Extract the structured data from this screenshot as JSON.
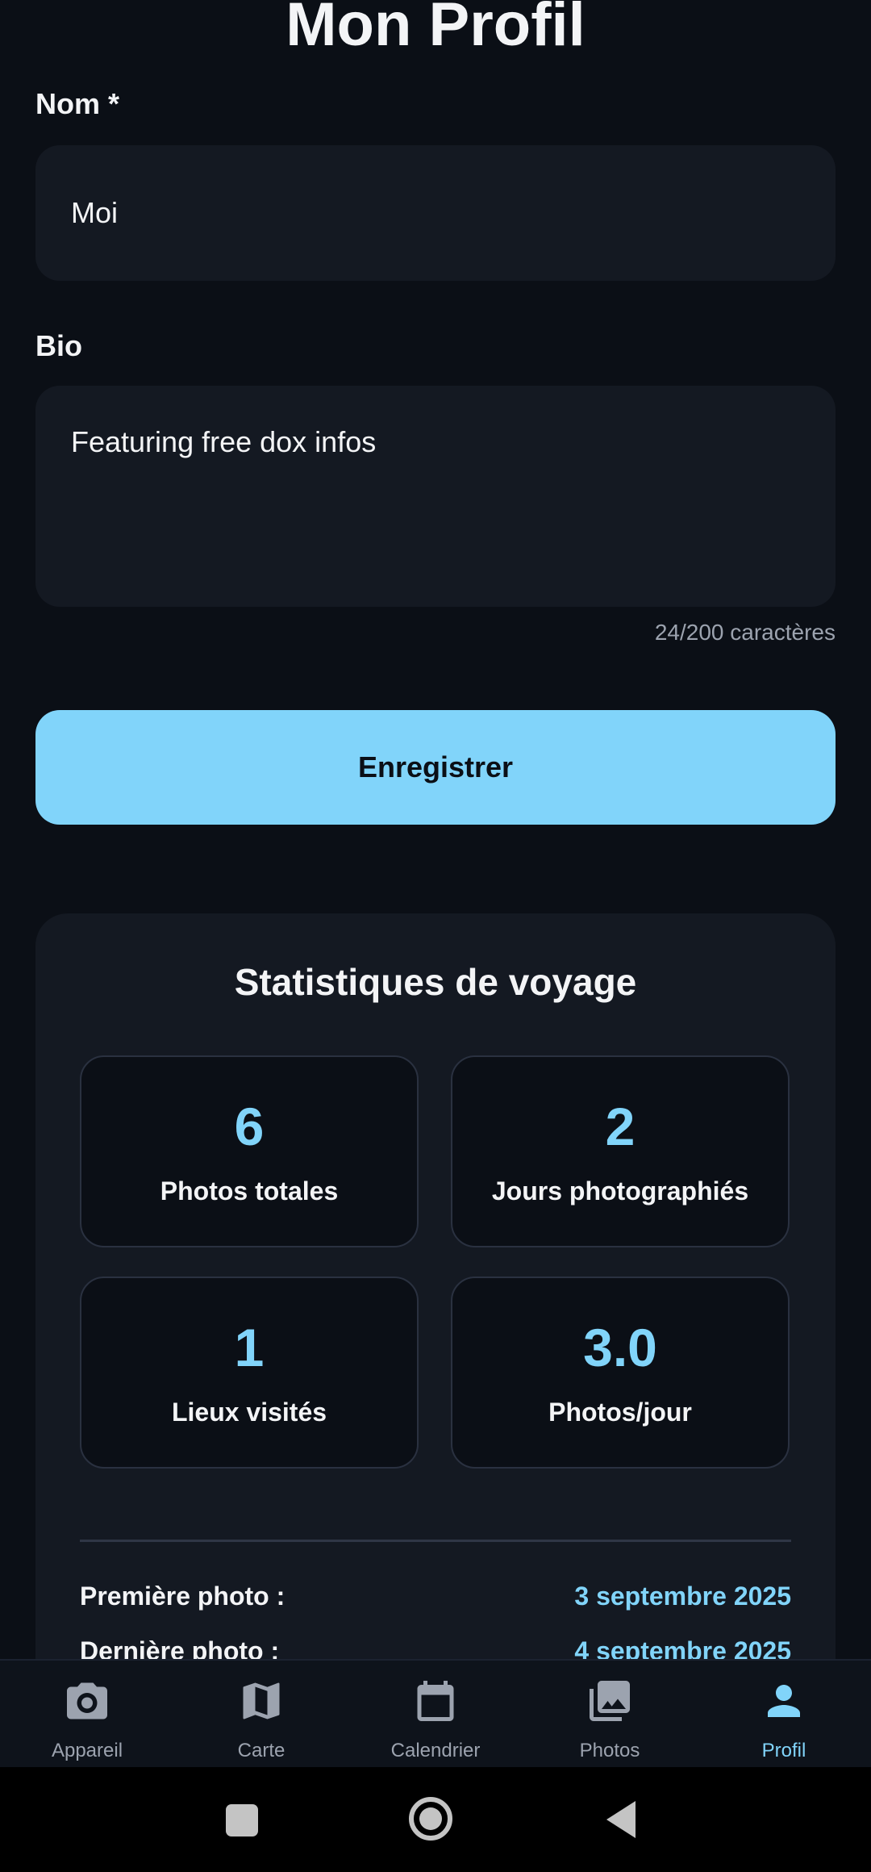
{
  "page": {
    "title": "Mon Profil"
  },
  "form": {
    "name_label": "Nom *",
    "name_value": "Moi",
    "bio_label": "Bio",
    "bio_value": "Featuring free dox infos",
    "bio_counter": "24/200 caractères",
    "save_label": "Enregistrer"
  },
  "stats": {
    "title": "Statistiques de voyage",
    "items": [
      {
        "value": "6",
        "label": "Photos totales"
      },
      {
        "value": "2",
        "label": "Jours photographiés"
      },
      {
        "value": "1",
        "label": "Lieux visités"
      },
      {
        "value": "3.0",
        "label": "Photos/jour"
      }
    ],
    "first_photo_label": "Première photo :",
    "first_photo_value": "3 septembre 2025",
    "last_photo_label": "Dernière photo :",
    "last_photo_value": "4 septembre 2025"
  },
  "nav": {
    "items": [
      {
        "label": "Appareil",
        "icon": "camera-icon"
      },
      {
        "label": "Carte",
        "icon": "map-icon"
      },
      {
        "label": "Calendrier",
        "icon": "calendar-icon"
      },
      {
        "label": "Photos",
        "icon": "photo-library-icon"
      },
      {
        "label": "Profil",
        "icon": "person-icon",
        "active": true
      }
    ]
  },
  "colors": {
    "background": "#0b0f16",
    "surface": "#141922",
    "accent": "#81d4fa",
    "text": "#f3f4f6",
    "muted": "#9ca3af"
  }
}
